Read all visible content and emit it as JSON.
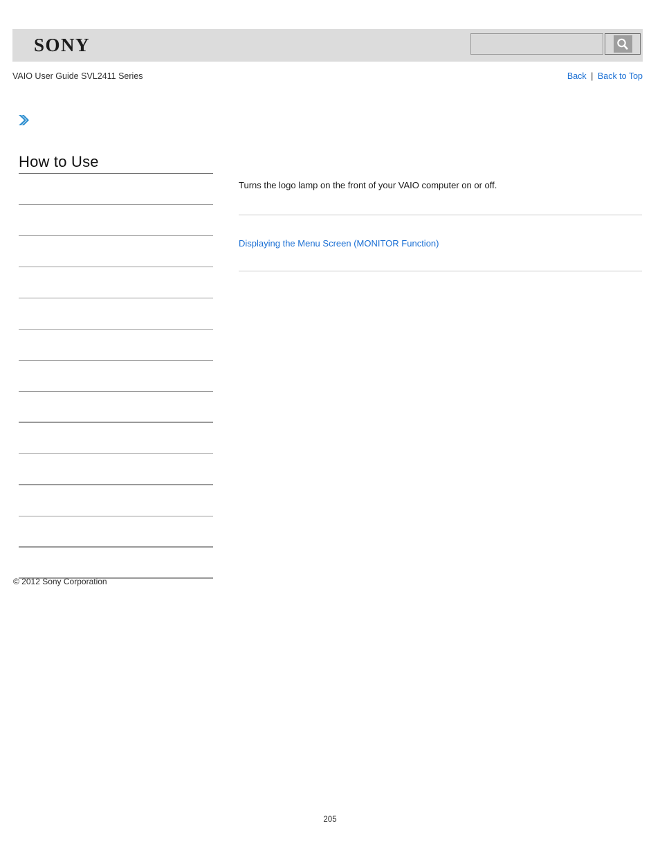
{
  "header": {
    "logo_text": "SONY",
    "logo_icon": "sony-wordmark",
    "search": {
      "value": "",
      "placeholder": "",
      "icon": "magnifier-icon",
      "button_label": ""
    }
  },
  "subheader": {
    "guide_title": "VAIO User Guide SVL2411 Series",
    "nav": {
      "back_label": "Back",
      "separator": "|",
      "back_to_top_label": "Back to Top"
    }
  },
  "marker": {
    "icon": "chevron-right-icon",
    "color": "#2e8fd0"
  },
  "sidebar": {
    "heading": "How to Use",
    "items": [
      {
        "label": ""
      },
      {
        "label": ""
      },
      {
        "label": ""
      },
      {
        "label": ""
      },
      {
        "label": ""
      },
      {
        "label": ""
      },
      {
        "label": ""
      },
      {
        "label": ""
      },
      {
        "label": ""
      },
      {
        "label": ""
      },
      {
        "label": ""
      },
      {
        "label": ""
      },
      {
        "label": ""
      }
    ]
  },
  "main": {
    "description": "Turns the logo lamp on the front of your VAIO computer on or off.",
    "related_link": "Displaying the Menu Screen (MONITOR Function)"
  },
  "footer": {
    "copyright": "© 2012 Sony Corporation",
    "page_number": "205"
  },
  "colors": {
    "link": "#1a6fd4",
    "header_band": "#dcdcdc",
    "rule": "#c9c9c9",
    "accent": "#2e8fd0"
  }
}
